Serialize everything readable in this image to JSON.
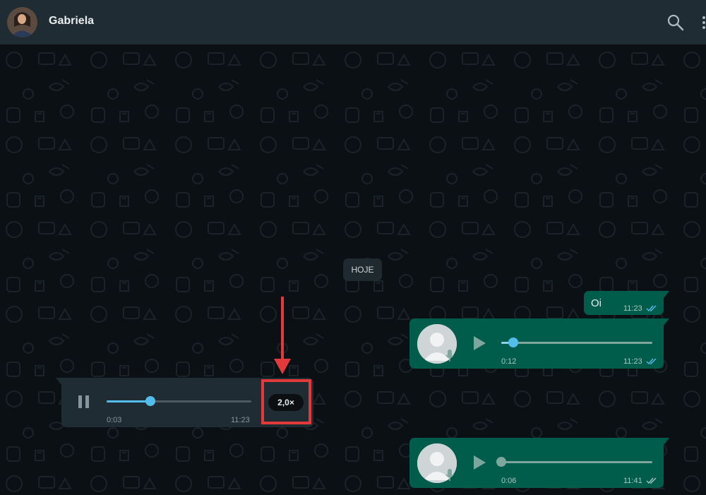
{
  "header": {
    "contact_name": "Gabriela",
    "icons": [
      "avatar-photo",
      "search-icon",
      "menu-icon"
    ]
  },
  "chat": {
    "date_chip": "HOJE",
    "messages": [
      {
        "type": "text",
        "direction": "outgoing",
        "text": "Oi",
        "time": "11:23",
        "status": "read"
      },
      {
        "type": "voice",
        "direction": "outgoing",
        "duration": "0:12",
        "time": "11:23",
        "status": "read",
        "playback_progress": 0.08
      },
      {
        "type": "voice",
        "direction": "incoming",
        "elapsed": "0:03",
        "time": "11:23",
        "playing": true,
        "playback_speed": "2,0×",
        "playback_progress": 0.3
      },
      {
        "type": "voice",
        "direction": "outgoing",
        "duration": "0:06",
        "time": "11:41",
        "status": "delivered",
        "playback_progress": 0.0
      }
    ]
  },
  "colors": {
    "header_bg": "#202c33",
    "chat_bg": "#0b1014",
    "outgoing_bubble": "#005c4b",
    "incoming_bubble": "#202c33",
    "read_ticks": "#53bdeb",
    "annotation": "#e23a3a"
  }
}
